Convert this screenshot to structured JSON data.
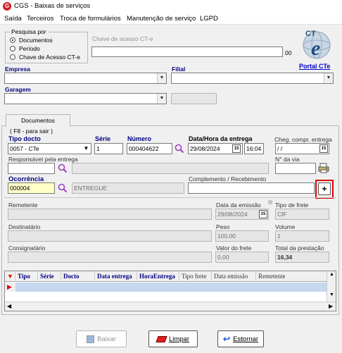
{
  "window": {
    "title": "CGS - Baixas de serviços",
    "logo_letter": "G"
  },
  "menu": [
    "Saída",
    "Terceiros",
    "Troca de formulários",
    "Manutenção de serviço",
    "LGPD"
  ],
  "search": {
    "group_label": "Pesquisa por",
    "options": [
      "Documentos",
      "Período",
      "Chave de Acesso CT-e"
    ],
    "selected": "Documentos",
    "chave_label": "Chave de acesso CT-e",
    "chave_suffix": "00"
  },
  "portal_link": "Portal CTe",
  "logo_text": "CT",
  "logo_e": "e",
  "empresa_label": "Empresa",
  "filial_label": "Filial",
  "garagem_label": "Garagem",
  "tab_label": "Documentos",
  "hint": "( F8 - para sair )",
  "doc": {
    "tipo_label": "Tipo docto",
    "tipo_value": "0057 - CTe",
    "serie_label": "Série",
    "serie_value": "1",
    "numero_label": "Número",
    "numero_value": "000404622",
    "data_label": "Data/Hora da entrega",
    "data_value": "29/08/2024",
    "hora_value": "16:04",
    "cheg_label": "Cheg. compr. entrega",
    "cheg_value": " / /"
  },
  "resp_label": "Responsável pela entrega",
  "via_label": "N° da via",
  "ocorrencia": {
    "label": "Ocorrência",
    "code": "000004",
    "desc": "ENTREGUE"
  },
  "complemento_label": "Complemento / Recebimento",
  "add_button": "+",
  "info": {
    "remetente_label": "Remetente",
    "emissao_label": "Data da emissão",
    "emissao_value": "29/08/2024",
    "tipo_frete_label": "Tipo de frete",
    "tipo_frete_value": "CIF",
    "destinatario_label": "Destinatário",
    "peso_label": "Peso",
    "peso_value": "100,00",
    "volume_label": "Volume",
    "volume_value": "1",
    "consignatario_label": "Consignatário",
    "valor_label": "Valor do frete",
    "valor_value": "0,00",
    "total_label": "Total da prestação",
    "total_value": "16,34"
  },
  "grid": {
    "columns": [
      "Tipo",
      "Série",
      "Docto",
      "Data entrega",
      "HoraEntrega",
      "Tipo frete",
      "Data emissão",
      "Remetente"
    ]
  },
  "buttons": {
    "baixar": "Baixar",
    "limpar": "Limpar",
    "estornar": "Estornar"
  },
  "colors": {
    "title_blue": "#000080",
    "highlight_red": "#e00000",
    "row_blue": "#c6d7f0",
    "yellow_input": "#ffffc8"
  }
}
